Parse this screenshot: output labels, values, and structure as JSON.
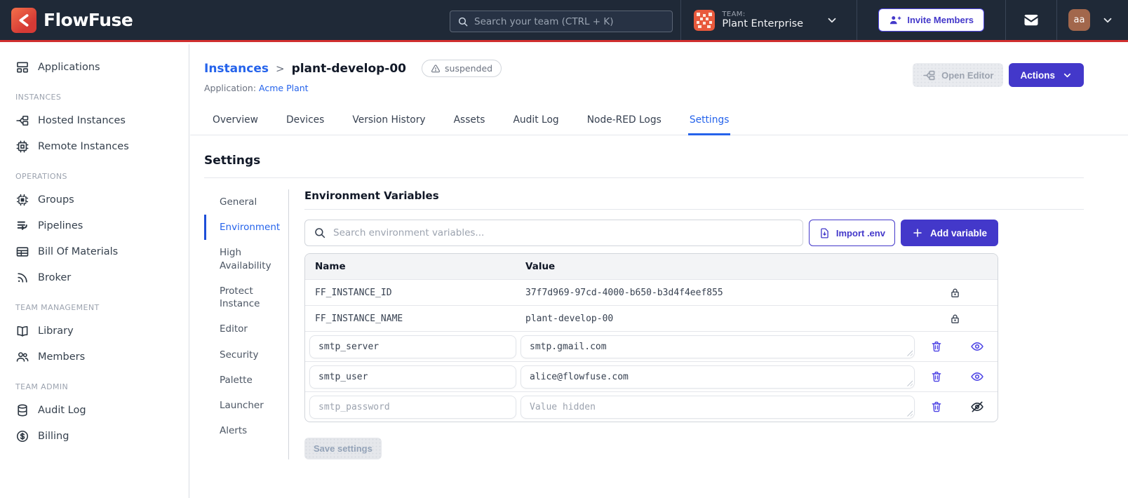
{
  "navbar": {
    "brand": "FlowFuse",
    "search_placeholder": "Search your team (CTRL + K)",
    "team_label": "TEAM:",
    "team_name": "Plant Enterprise",
    "invite_button": "Invite Members",
    "avatar_initials": "aa",
    "icons": [
      "flowfuse-logo",
      "search-icon",
      "team-identicon",
      "chevron-down-icon",
      "user-plus-icon",
      "mail-icon"
    ]
  },
  "sidebar": {
    "sections": [
      {
        "label": "",
        "items": [
          {
            "label": "Applications",
            "icon": "applications-icon"
          }
        ]
      },
      {
        "label": "INSTANCES",
        "items": [
          {
            "label": "Hosted Instances",
            "icon": "flow-icon"
          },
          {
            "label": "Remote Instances",
            "icon": "chip-icon"
          }
        ]
      },
      {
        "label": "OPERATIONS",
        "items": [
          {
            "label": "Groups",
            "icon": "device-group-icon"
          },
          {
            "label": "Pipelines",
            "icon": "pipelines-icon"
          },
          {
            "label": "Bill Of Materials",
            "icon": "table-icon"
          },
          {
            "label": "Broker",
            "icon": "rss-icon"
          }
        ]
      },
      {
        "label": "TEAM MANAGEMENT",
        "items": [
          {
            "label": "Library",
            "icon": "book-icon"
          },
          {
            "label": "Members",
            "icon": "users-icon"
          }
        ]
      },
      {
        "label": "TEAM ADMIN",
        "items": [
          {
            "label": "Audit Log",
            "icon": "database-icon"
          },
          {
            "label": "Billing",
            "icon": "currency-dollar-icon"
          }
        ]
      }
    ]
  },
  "header": {
    "breadcrumb_root": "Instances",
    "breadcrumb_separator": ">",
    "instance_name": "plant-develop-00",
    "status_badge": "suspended",
    "application_label": "Application:",
    "application_name": "Acme Plant",
    "open_editor_button": "Open Editor",
    "actions_button": "Actions"
  },
  "tabs": {
    "items": [
      {
        "label": "Overview"
      },
      {
        "label": "Devices"
      },
      {
        "label": "Version History"
      },
      {
        "label": "Assets"
      },
      {
        "label": "Audit Log"
      },
      {
        "label": "Node-RED Logs"
      },
      {
        "label": "Settings"
      }
    ],
    "active": "Settings"
  },
  "settings": {
    "title": "Settings",
    "nav": [
      "General",
      "Environment",
      "High Availability",
      "Protect Instance",
      "Editor",
      "Security",
      "Palette",
      "Launcher",
      "Alerts"
    ],
    "active_nav": "Environment",
    "env": {
      "heading": "Environment Variables",
      "search_placeholder": "Search environment variables...",
      "import_button": "Import .env",
      "add_button": "Add variable",
      "columns": {
        "name": "Name",
        "value": "Value"
      },
      "rows": [
        {
          "name": "FF_INSTANCE_ID",
          "value": "37f7d969-97cd-4000-b650-b3d4f4eef855",
          "locked": true
        },
        {
          "name": "FF_INSTANCE_NAME",
          "value": "plant-develop-00",
          "locked": true
        },
        {
          "name": "smtp_server",
          "value": "smtp.gmail.com",
          "locked": false
        },
        {
          "name": "smtp_user",
          "value": "alice@flowfuse.com",
          "locked": false
        },
        {
          "name": "smtp_password",
          "value": "",
          "value_placeholder": "Value hidden",
          "locked": false,
          "hidden": true
        }
      ],
      "save_button": "Save settings"
    }
  },
  "colors": {
    "navbar_bg": "#1f2937",
    "accent_red": "#d12f2f",
    "primary_indigo": "#4338ca",
    "link_blue": "#2563eb",
    "team_icon_orange": "#e8593c",
    "avatar_brown": "#a2674c"
  }
}
